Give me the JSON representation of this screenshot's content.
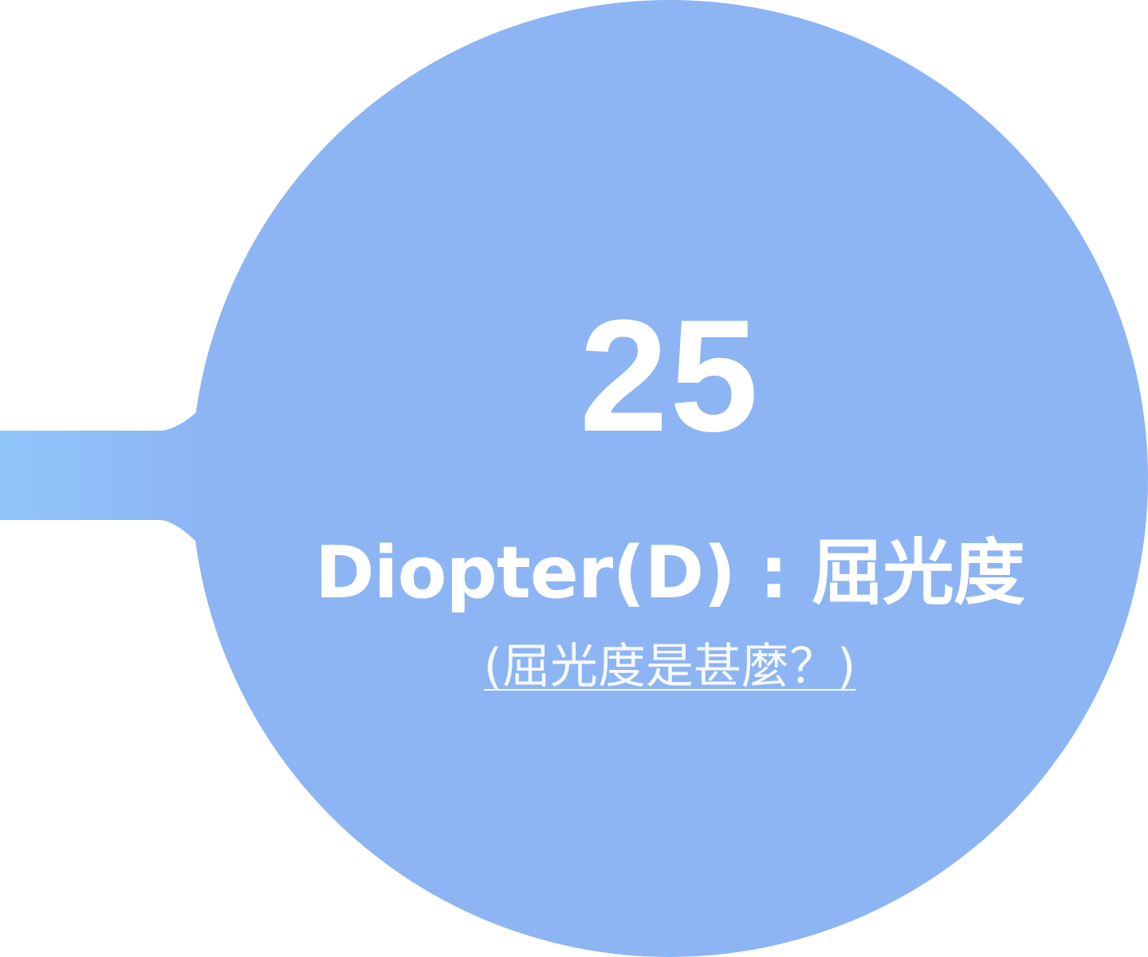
{
  "metric": {
    "value": "25",
    "label": "Diopter(D) : 屈光度",
    "link_text": "(屈光度是甚麼？)"
  },
  "colors": {
    "circle": "#8db5f3",
    "connector_start": "#91c6fb",
    "connector_end": "#8db5f3",
    "text": "#ffffff",
    "background": "#ffffff"
  }
}
